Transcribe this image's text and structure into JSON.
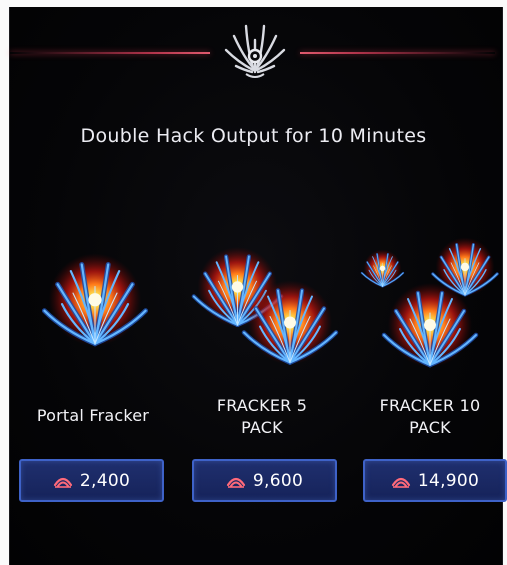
{
  "offer": {
    "description": "Double Hack Output for 10 Minutes"
  },
  "items": [
    {
      "name_line1": "Portal Fracker",
      "name_line2": "",
      "price": "2,400"
    },
    {
      "name_line1": "FRACKER 5",
      "name_line2": "PACK",
      "price": "9,600"
    },
    {
      "name_line1": "FRACKER 10",
      "name_line2": "PACK",
      "price": "14,900"
    }
  ],
  "icons": {
    "header": "fracker-emblem-icon",
    "currency": "cmu-currency-icon",
    "item_art": "portal-fracker-icon"
  },
  "colors": {
    "background": "#050507",
    "accent_line": "#b0334a",
    "button_fill": "#1b2a66",
    "button_border": "#3e62c8",
    "currency_icon": "#ff6a7a",
    "text": "#f2f2f6"
  }
}
